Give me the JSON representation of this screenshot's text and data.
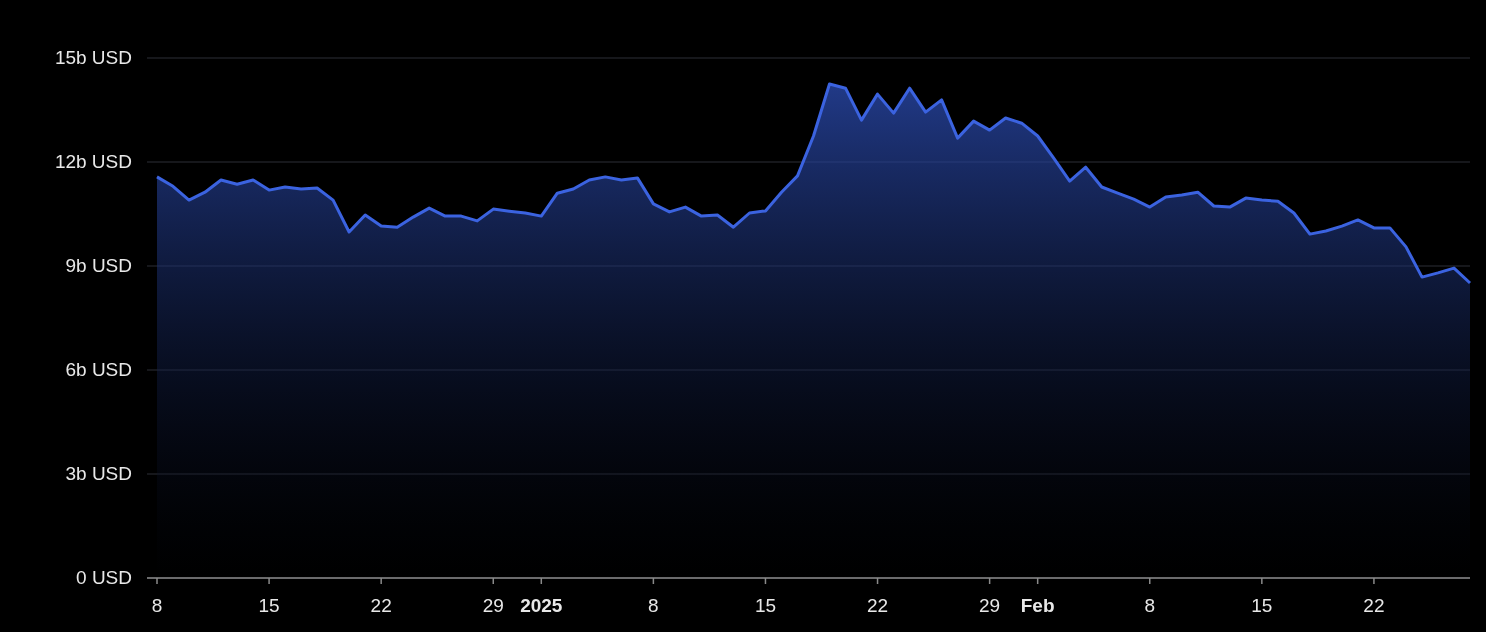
{
  "chart_data": {
    "type": "area",
    "grid": true,
    "ylim": [
      0,
      15
    ],
    "categories": [
      "8",
      null,
      null,
      null,
      null,
      null,
      null,
      "15",
      null,
      null,
      null,
      null,
      null,
      null,
      "22",
      null,
      null,
      null,
      null,
      null,
      null,
      "29",
      null,
      null,
      "**2025**",
      null,
      null,
      null,
      null,
      null,
      null,
      "8",
      null,
      null,
      null,
      null,
      null,
      null,
      "15",
      null,
      null,
      null,
      null,
      null,
      null,
      "22",
      null,
      null,
      null,
      null,
      null,
      null,
      "29",
      null,
      null,
      "**Feb**",
      null,
      null,
      null,
      null,
      null,
      null,
      "8",
      null,
      null,
      null,
      null,
      null,
      null,
      "15",
      null,
      null,
      null,
      null,
      null,
      null,
      "22",
      null,
      null,
      null,
      null,
      null,
      null
    ],
    "series": [
      {
        "color": "#3b63e0",
        "values": [
          11.57,
          11.3,
          10.9,
          11.13,
          11.48,
          11.36,
          11.48,
          11.19,
          11.28,
          11.22,
          11.25,
          10.9,
          9.98,
          10.47,
          10.15,
          10.12,
          10.41,
          10.67,
          10.44,
          10.44,
          10.3,
          10.64,
          10.58,
          10.53,
          10.44,
          11.1,
          11.22,
          11.48,
          11.57,
          11.48,
          11.54,
          10.79,
          10.56,
          10.7,
          10.44,
          10.47,
          10.12,
          10.53,
          10.59,
          11.13,
          11.6,
          12.75,
          14.25,
          14.13,
          13.21,
          13.96,
          13.41,
          14.13,
          13.44,
          13.79,
          12.69,
          13.18,
          12.92,
          13.27,
          13.12,
          12.75,
          12.11,
          11.45,
          11.85,
          11.28,
          11.1,
          10.93,
          10.7,
          10.99,
          11.05,
          11.13,
          10.73,
          10.7,
          10.96,
          10.9,
          10.87,
          10.53,
          9.92,
          10.01,
          10.15,
          10.33,
          10.1,
          10.1,
          9.55,
          8.68,
          8.8,
          8.94,
          8.51
        ]
      }
    ],
    "yticks": [
      {
        "value": 0,
        "label": "0 USD"
      },
      {
        "value": 3,
        "label": "3b USD"
      },
      {
        "value": 6,
        "label": "6b USD"
      },
      {
        "value": 9,
        "label": "9b USD"
      },
      {
        "value": 12,
        "label": "12b USD"
      },
      {
        "value": 15,
        "label": "15b USD"
      }
    ]
  }
}
